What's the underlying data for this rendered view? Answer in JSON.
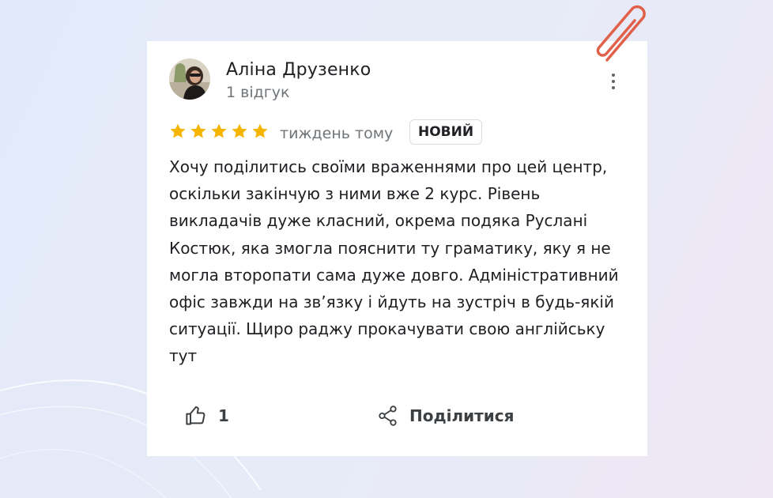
{
  "review": {
    "reviewer": {
      "name": "Аліна Друзенко",
      "review_count": "1 відгук"
    },
    "rating": 5,
    "date": "тиждень тому",
    "badge": "НОВИЙ",
    "text_lines": [
      "Хочу поділитись своїми враженнями про цей центр,",
      "оскільки закінчую з ними вже 2 курс. Рівень",
      "викладачів дуже класний, окрема подяка Руслані",
      "Костюк, яка змогла пояснити ту граматику, яку я не",
      "могла второпати сама дуже довго. Адміністративний",
      "офіс завжди на зв’язку і йдуть на зустріч в будь-якій",
      "ситуації. Щиро раджу прокачувати свою англійську",
      "тут"
    ],
    "actions": {
      "like_count": "1",
      "share_label": "Поділитися"
    }
  },
  "colors": {
    "star": "#f4b400",
    "paperclip": "#e0604a",
    "text": "#202124",
    "muted": "#70757a"
  },
  "icons": [
    "avatar-photo",
    "more-vert-icon",
    "star-icon",
    "thumb-up-icon",
    "share-icon",
    "paperclip-icon"
  ]
}
